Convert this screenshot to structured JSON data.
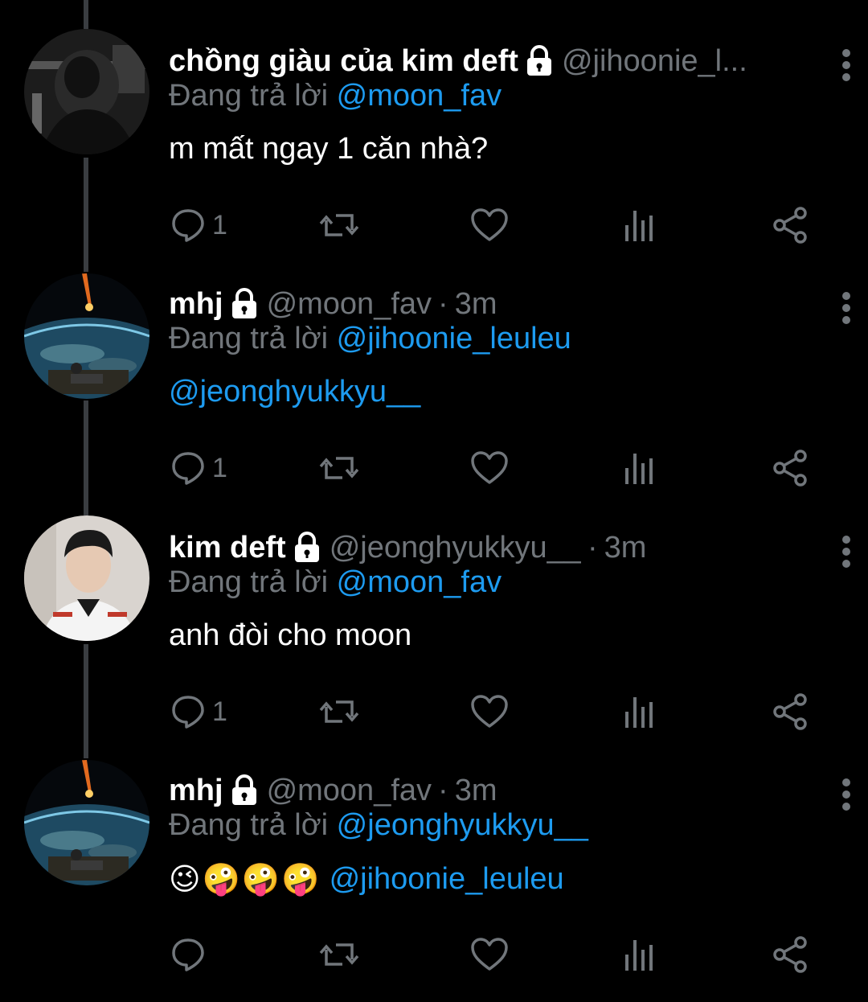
{
  "reply_prefix": "Đang trả lời",
  "tweets": [
    {
      "name": "chồng giàu của kim deft",
      "handle": "@jihoonie_l...",
      "time": "",
      "reply_to": "@moon_fav",
      "text": "m mất ngay 1 căn nhà?",
      "mention": "",
      "reply_count": "1",
      "avatar": "dark-hooded-figure"
    },
    {
      "name": "mhj",
      "handle": "@moon_fav",
      "time": "3m",
      "reply_to": "@jihoonie_leuleu",
      "text": "",
      "mention": "@jeonghyukkyu__",
      "reply_count": "1",
      "avatar": "earth-meteor"
    },
    {
      "name": "kim deft",
      "handle": "@jeonghyukkyu__",
      "time": "3m",
      "reply_to": "@moon_fav",
      "text": "anh đòi cho moon",
      "mention": "",
      "reply_count": "1",
      "avatar": "young-man-white-jacket"
    },
    {
      "name": "mhj",
      "handle": "@moon_fav",
      "time": "3m",
      "reply_to": "@jeonghyukkyu__",
      "text": "😉🤪🤪🤪",
      "mention": "@jihoonie_leuleu",
      "reply_count": "",
      "avatar": "earth-meteor"
    }
  ],
  "colors": {
    "background": "#000000",
    "accent": "#1d9bf0",
    "muted": "#71767b",
    "thread_line": "#3a3d41"
  },
  "icons": [
    "reply-icon",
    "retweet-icon",
    "like-icon",
    "views-icon",
    "share-icon",
    "lock-icon",
    "more-icon"
  ]
}
